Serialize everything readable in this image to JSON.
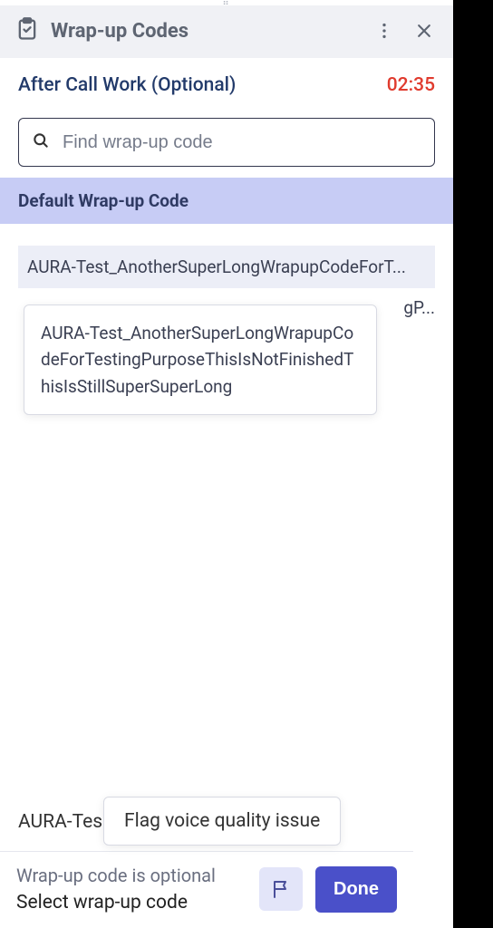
{
  "header": {
    "title": "Wrap-up Codes"
  },
  "acw": {
    "label": "After Call Work (Optional)",
    "timer": "02:35"
  },
  "search": {
    "placeholder": "Find wrap-up code"
  },
  "section": {
    "default_label": "Default Wrap-up Code"
  },
  "codes": {
    "row1_truncated": "AURA-Test_AnotherSuperLongWrapupCodeForT...",
    "row2_trailing_fragment": "gP...",
    "tooltip_full": "AURA-Test_AnotherSuperLongWrapupCodeForTestingPurposeThisIsNotFinishedThisIsStillSuperSuperLong"
  },
  "footer": {
    "selected_tag_truncated": "AURA-Tes",
    "flag_popup_label": "Flag voice quality issue",
    "optional_line": "Wrap-up code is optional",
    "select_line": "Select wrap-up code",
    "done_label": "Done"
  }
}
